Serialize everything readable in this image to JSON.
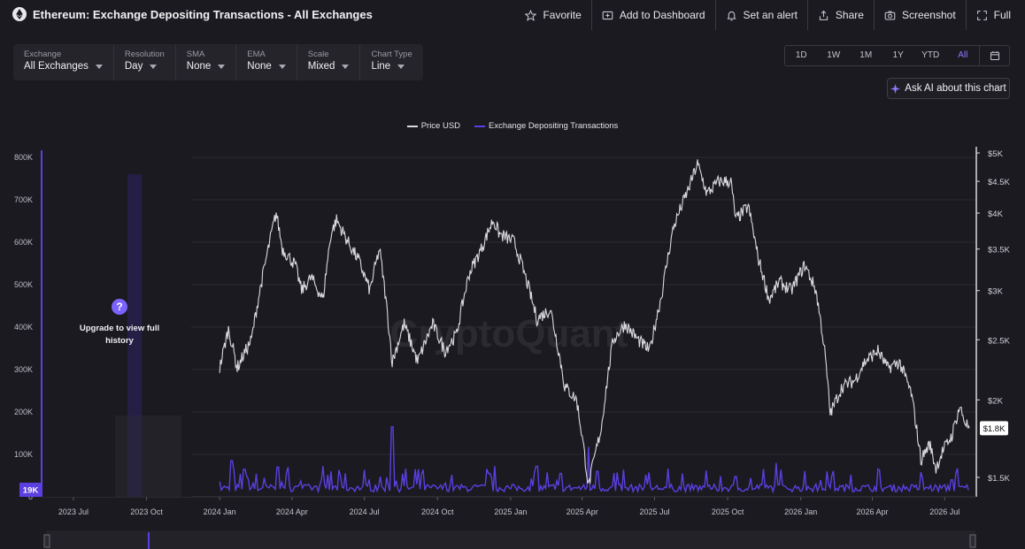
{
  "header": {
    "title": "Ethereum: Exchange Depositing Transactions - All Exchanges",
    "actions": [
      {
        "label": "Favorite",
        "icon": "star-icon"
      },
      {
        "label": "Add to Dashboard",
        "icon": "dashboard-add-icon"
      },
      {
        "label": "Set an alert",
        "icon": "bell-icon"
      },
      {
        "label": "Share",
        "icon": "share-icon"
      },
      {
        "label": "Screenshot",
        "icon": "camera-icon"
      },
      {
        "label": "Full",
        "icon": "fullscreen-icon"
      }
    ]
  },
  "filters": [
    {
      "label": "Exchange",
      "value": "All Exchanges"
    },
    {
      "label": "Resolution",
      "value": "Day"
    },
    {
      "label": "SMA",
      "value": "None"
    },
    {
      "label": "EMA",
      "value": "None"
    },
    {
      "label": "Scale",
      "value": "Mixed"
    },
    {
      "label": "Chart Type",
      "value": "Line"
    }
  ],
  "ranges": [
    "1D",
    "1W",
    "1M",
    "1Y",
    "YTD",
    "All"
  ],
  "active_range": "All",
  "ask_ai": "Ask AI about this chart",
  "upgrade": {
    "text": "Upgrade to view full history",
    "icon": "question-icon"
  },
  "colors": {
    "price": "#d9d9de",
    "deposits": "#5b3fe0",
    "accent": "#7a63ff",
    "background": "#1b1a20"
  },
  "chart_data": {
    "type": "line",
    "series": [
      {
        "name": "Price USD",
        "axis": "right"
      },
      {
        "name": "Exchange Depositing Transactions",
        "axis": "left"
      }
    ],
    "left_axis": {
      "ticks": [
        "800K",
        "700K",
        "600K",
        "500K",
        "400K",
        "300K",
        "200K",
        "100K",
        "0"
      ],
      "ylim": [
        0,
        800000
      ]
    },
    "right_axis": {
      "ticks": [
        "$5K",
        "$4.5K",
        "$4K",
        "$3.5K",
        "$3K",
        "$2.5K",
        "$2K",
        "$1.5K"
      ],
      "ticks_values": [
        5000,
        4500,
        4000,
        3500,
        3000,
        2500,
        2000,
        1500
      ],
      "scale": "log"
    },
    "x_ticks": [
      "2023 Jul",
      "2023 Oct",
      "2024 Jan",
      "2024 Apr",
      "2024 Jul",
      "2024 Oct",
      "2025 Jan",
      "2025 Apr",
      "2025 Jul",
      "2025 Oct",
      "2026 Jan",
      "2026 Apr",
      "2026 Jul"
    ],
    "price_points": [
      [
        "2024-01-01",
        2250
      ],
      [
        "2024-01-12",
        2600
      ],
      [
        "2024-01-23",
        2250
      ],
      [
        "2024-02-10",
        2500
      ],
      [
        "2024-02-28",
        3350
      ],
      [
        "2024-03-12",
        4000
      ],
      [
        "2024-03-20",
        3500
      ],
      [
        "2024-04-05",
        3300
      ],
      [
        "2024-04-13",
        3000
      ],
      [
        "2024-04-25",
        3150
      ],
      [
        "2024-05-10",
        2900
      ],
      [
        "2024-05-20",
        3700
      ],
      [
        "2024-05-27",
        3900
      ],
      [
        "2024-06-10",
        3600
      ],
      [
        "2024-06-24",
        3350
      ],
      [
        "2024-07-08",
        3000
      ],
      [
        "2024-07-20",
        3500
      ],
      [
        "2024-08-05",
        2300
      ],
      [
        "2024-08-20",
        2650
      ],
      [
        "2024-09-06",
        2300
      ],
      [
        "2024-09-25",
        2650
      ],
      [
        "2024-10-10",
        2400
      ],
      [
        "2024-10-25",
        2550
      ],
      [
        "2024-11-10",
        3200
      ],
      [
        "2024-11-25",
        3500
      ],
      [
        "2024-12-10",
        3900
      ],
      [
        "2024-12-18",
        3700
      ],
      [
        "2025-01-05",
        3600
      ],
      [
        "2025-01-15",
        3300
      ],
      [
        "2025-02-03",
        2700
      ],
      [
        "2025-02-20",
        2800
      ],
      [
        "2025-03-10",
        2100
      ],
      [
        "2025-03-25",
        2000
      ],
      [
        "2025-04-09",
        1450
      ],
      [
        "2025-04-25",
        1800
      ],
      [
        "2025-05-10",
        2500
      ],
      [
        "2025-05-25",
        2650
      ],
      [
        "2025-06-10",
        2500
      ],
      [
        "2025-06-25",
        2400
      ],
      [
        "2025-07-10",
        2950
      ],
      [
        "2025-07-25",
        3800
      ],
      [
        "2025-08-12",
        4350
      ],
      [
        "2025-08-24",
        4800
      ],
      [
        "2025-09-05",
        4300
      ],
      [
        "2025-09-20",
        4500
      ],
      [
        "2025-10-05",
        4500
      ],
      [
        "2025-10-11",
        3900
      ],
      [
        "2025-10-27",
        4100
      ],
      [
        "2025-11-08",
        3400
      ],
      [
        "2025-11-22",
        2900
      ],
      [
        "2025-12-05",
        3100
      ],
      [
        "2025-12-20",
        3000
      ],
      [
        "2026-01-06",
        3300
      ],
      [
        "2026-01-20",
        3000
      ],
      [
        "2026-01-31",
        2400
      ],
      [
        "2026-02-07",
        1900
      ],
      [
        "2026-02-22",
        2100
      ],
      [
        "2026-03-10",
        2150
      ],
      [
        "2026-03-22",
        2300
      ],
      [
        "2026-04-08",
        2400
      ],
      [
        "2026-04-20",
        2250
      ],
      [
        "2026-05-05",
        2300
      ],
      [
        "2026-05-20",
        2050
      ],
      [
        "2026-06-01",
        1600
      ],
      [
        "2026-06-12",
        1700
      ],
      [
        "2026-06-20",
        1550
      ],
      [
        "2026-06-28",
        1650
      ],
      [
        "2026-07-10",
        1750
      ],
      [
        "2026-07-20",
        1950
      ],
      [
        "2026-07-26",
        1850
      ],
      [
        "2026-08-01",
        1800
      ]
    ],
    "deposit_baseline": 22000,
    "deposit_spikes": [
      [
        "2023-09-16",
        760000
      ],
      [
        "2024-01-16",
        85000
      ],
      [
        "2024-02-01",
        65000
      ],
      [
        "2024-03-14",
        70000
      ],
      [
        "2024-05-20",
        60000
      ],
      [
        "2024-08-05",
        165000
      ],
      [
        "2024-12-05",
        55000
      ],
      [
        "2025-02-03",
        72000
      ],
      [
        "2025-03-05",
        55000
      ],
      [
        "2025-04-09",
        118000
      ],
      [
        "2025-04-20",
        60000
      ],
      [
        "2025-06-20",
        52000
      ],
      [
        "2025-08-05",
        55000
      ],
      [
        "2025-10-11",
        48000
      ],
      [
        "2025-12-01",
        80000
      ],
      [
        "2026-02-03",
        60000
      ],
      [
        "2026-03-05",
        52000
      ],
      [
        "2026-06-01",
        58000
      ],
      [
        "2026-07-10",
        40000
      ]
    ],
    "last_price_label": "$1.8K",
    "last_deposit_label": "19K",
    "legend_position": "top-center",
    "watermark": "CryptoQuant"
  }
}
